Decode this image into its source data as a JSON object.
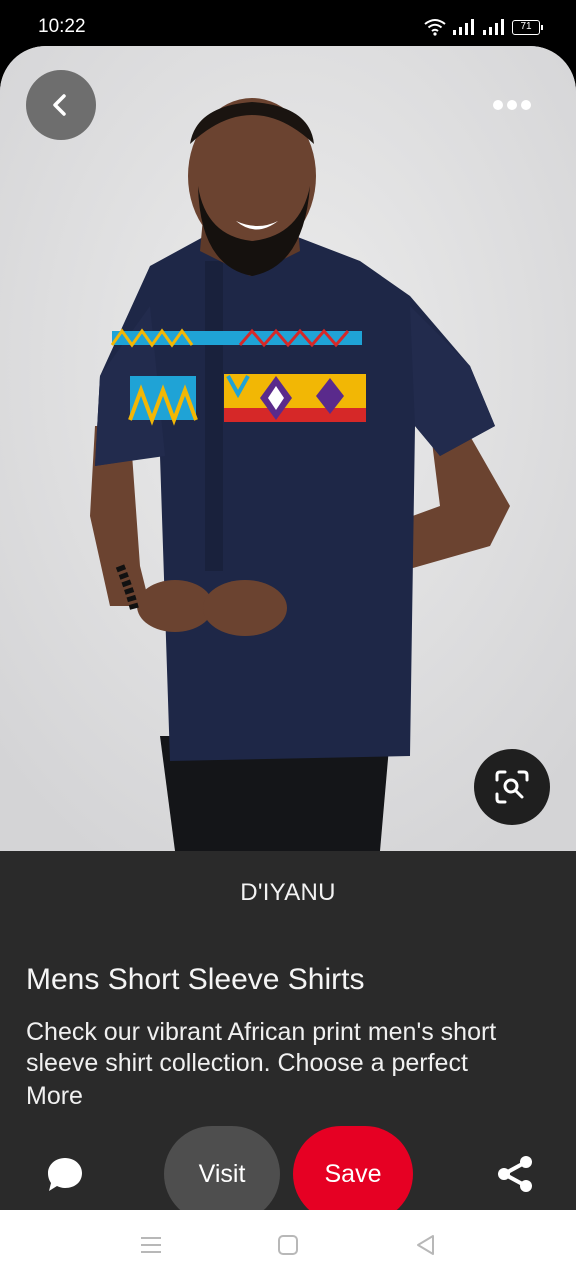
{
  "status_bar": {
    "time": "10:22",
    "battery": "71",
    "icons": [
      "wifi-icon",
      "signal-icon",
      "signal-icon",
      "battery-icon"
    ]
  },
  "pin": {
    "image_alt": "Man wearing navy short sleeve shirt with African print",
    "source": "D'IYANU",
    "title": "Mens Short Sleeve Shirts",
    "description": "Check our vibrant African print men's short sleeve shirt collection. Choose a perfect",
    "more_label": "More"
  },
  "actions": {
    "visit_label": "Visit",
    "save_label": "Save"
  },
  "colors": {
    "save_red": "#e60023",
    "panel_bg": "#2a2a2a",
    "visit_bg": "#4e4e4e"
  }
}
